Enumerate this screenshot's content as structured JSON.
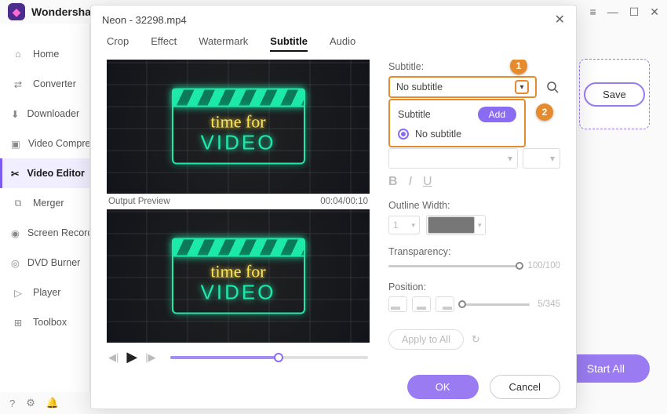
{
  "app": {
    "name": "Wondershare"
  },
  "sidebar": {
    "items": [
      {
        "label": "Home"
      },
      {
        "label": "Converter"
      },
      {
        "label": "Downloader"
      },
      {
        "label": "Video Compress"
      },
      {
        "label": "Video Editor"
      },
      {
        "label": "Merger"
      },
      {
        "label": "Screen Recorde"
      },
      {
        "label": "DVD Burner"
      },
      {
        "label": "Player"
      },
      {
        "label": "Toolbox"
      }
    ]
  },
  "right": {
    "save": "Save",
    "start_all": "Start All"
  },
  "modal": {
    "title": "Neon - 32298.mp4",
    "tabs": {
      "crop": "Crop",
      "effect": "Effect",
      "watermark": "Watermark",
      "subtitle": "Subtitle",
      "audio": "Audio"
    },
    "preview_label": "Output Preview",
    "time": "00:04/00:10",
    "neon_line1": "time for",
    "neon_line2": "VIDEO",
    "subtitle_section": {
      "label": "Subtitle:",
      "selected": "No subtitle",
      "dropdown_heading": "Subtitle",
      "add": "Add",
      "option_none": "No subtitle"
    },
    "callouts": {
      "one": "1",
      "two": "2"
    },
    "outline_label": "Outline Width:",
    "outline_value": "1",
    "transparency_label": "Transparency:",
    "transparency_value": "100/100",
    "position_label": "Position:",
    "position_value": "5/345",
    "apply": "Apply to All",
    "ok": "OK",
    "cancel": "Cancel"
  }
}
